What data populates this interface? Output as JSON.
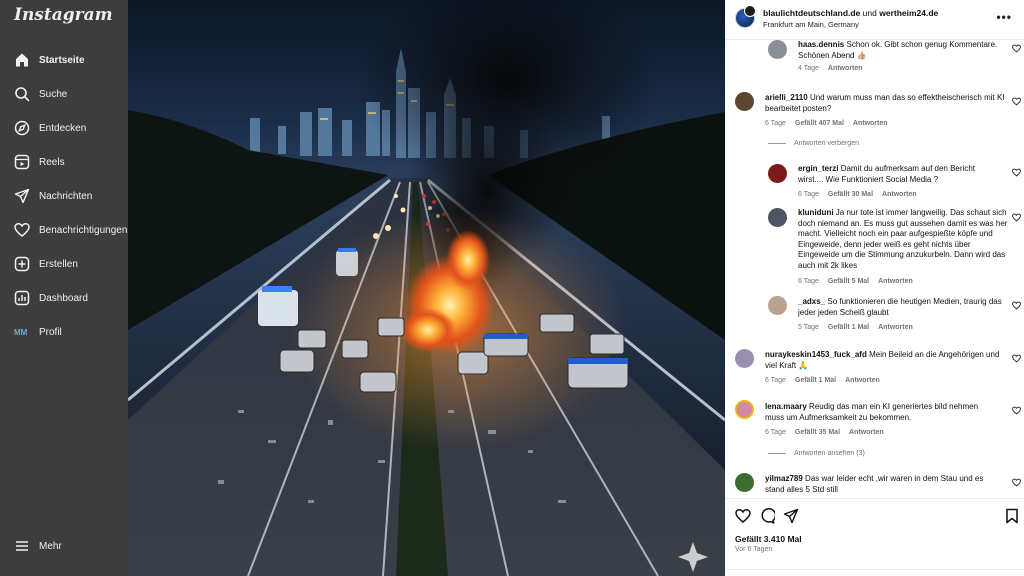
{
  "app": {
    "logo": "Instagram"
  },
  "sidebar": {
    "items": [
      {
        "label": "Startseite",
        "icon": "home-icon"
      },
      {
        "label": "Suche",
        "icon": "search-icon"
      },
      {
        "label": "Entdecken",
        "icon": "compass-icon"
      },
      {
        "label": "Reels",
        "icon": "reels-icon"
      },
      {
        "label": "Nachrichten",
        "icon": "messages-icon"
      },
      {
        "label": "Benachrichtigungen",
        "icon": "heart-icon"
      },
      {
        "label": "Erstellen",
        "icon": "plus-icon"
      },
      {
        "label": "Dashboard",
        "icon": "dashboard-icon"
      },
      {
        "label": "Profil",
        "icon": "profile-icon"
      }
    ],
    "more_label": "Mehr"
  },
  "post": {
    "user_a": "blaulichtdeutschland.de",
    "and": "und",
    "user_b": "wertheim24.de",
    "location": "Frankfurt am Main, Germany",
    "likes": "Gefällt 3.410 Mal",
    "ago": "Vor 6 Tagen"
  },
  "comments": [
    {
      "user": "haas.dennis",
      "text": "Schon ok. Gibt schon genug Kommentare. Schönen Abend 👍🏼",
      "time": "4 Tage",
      "likes": "",
      "reply": "Antworten"
    },
    {
      "user": "arielli_2110",
      "text": "Und warum muss man das so effektheischerisch mit KI bearbeitet posten?",
      "time": "6 Tage",
      "likes": "Gefällt 407 Mal",
      "reply": "Antworten"
    },
    {
      "user": "ergin_terzi",
      "text": "Damit du aufmerksam auf den Bericht wirst.... Wie Funktioniert Social Media ?",
      "time": "6 Tage",
      "likes": "Gefällt 30 Mal",
      "reply": "Antworten"
    },
    {
      "user": "kluniduni",
      "text": "Ja nur tote ist immer langweilig. Das schaut sich doch niemand an. Es muss gut aussehen damit es was her macht. Vielleicht noch ein paar aufgespießte köpfe und Eingeweide, denn jeder weiß es geht nichts über Eingeweide um die Stimmung anzukurbeln. Dann wird das auch mit 2k likes",
      "time": "6 Tage",
      "likes": "Gefällt 5 Mal",
      "reply": "Antworten"
    },
    {
      "user": "_adxs_",
      "text": "So funktionieren die heutigen Medien, traurig das jeder jeden Scheiß glaubt",
      "time": "5 Tage",
      "likes": "Gefällt 1 Mal",
      "reply": "Antworten"
    },
    {
      "user": "nuraykeskin1453_fuck_afd",
      "text": "Mein Beileid an die Angehörigen und viel Kraft 🙏",
      "time": "6 Tage",
      "likes": "Gefällt 1 Mal",
      "reply": "Antworten"
    },
    {
      "user": "lena.maary",
      "text": "Reudig das man ein KI generiertes bild nehmen muss um Aufmerksamkeit zu bekommen.",
      "time": "6 Tage",
      "likes": "Gefällt 35 Mal",
      "reply": "Antworten"
    },
    {
      "user": "yilmaz789",
      "text": "Das war leider echt ,wir waren in dem Stau und es stand alles 5 Std still",
      "time": "",
      "likes": "",
      "reply": ""
    }
  ],
  "toggles": {
    "hide": "Antworten verbergen",
    "show": "Antworten ansehen (3)"
  },
  "colors": {
    "sidebar_bg": "#3d3d3d",
    "panel_bg": "#ffffff",
    "meta": "#737373"
  }
}
